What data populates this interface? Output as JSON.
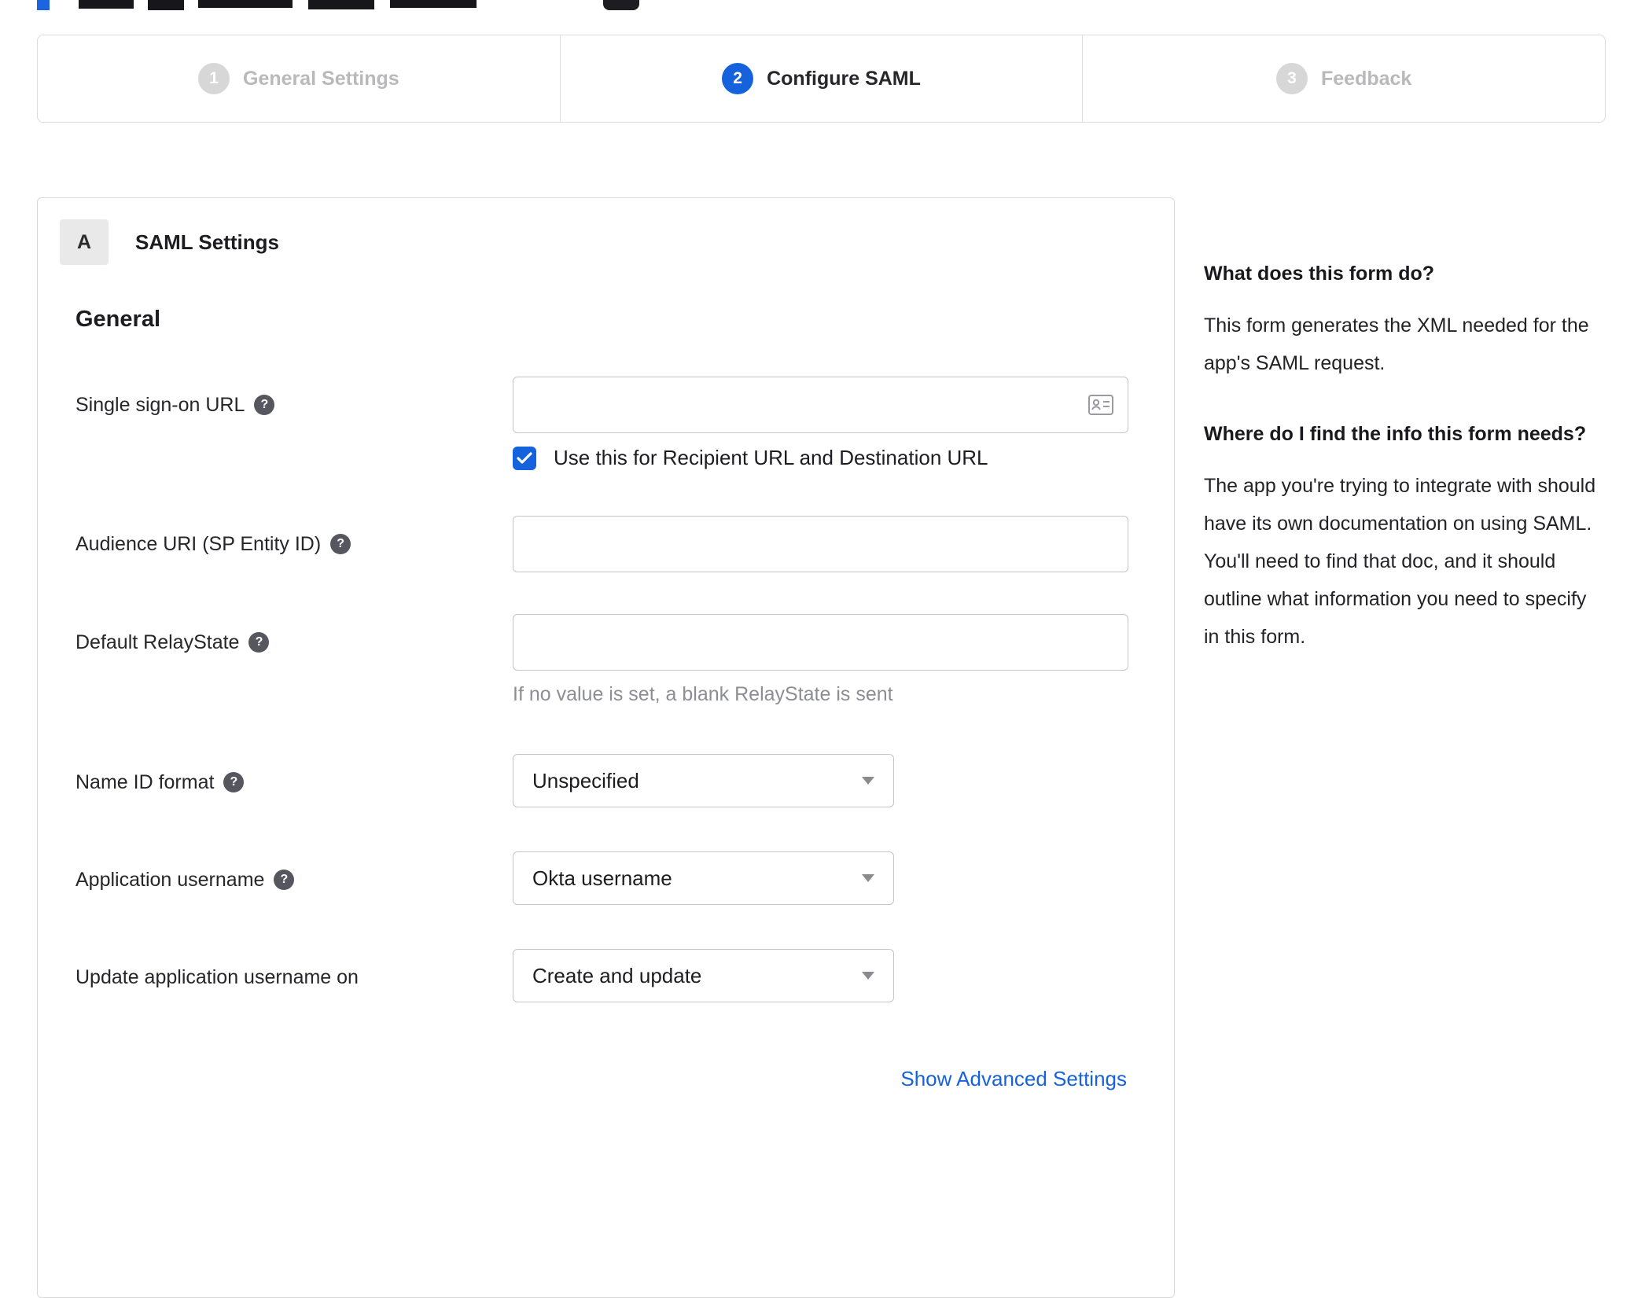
{
  "stepper": {
    "steps": [
      {
        "number": "1",
        "label": "General Settings",
        "state": "inactive"
      },
      {
        "number": "2",
        "label": "Configure SAML",
        "state": "active"
      },
      {
        "number": "3",
        "label": "Feedback",
        "state": "inactive"
      }
    ]
  },
  "panel": {
    "section_badge": "A",
    "section_title": "SAML Settings",
    "group_title": "General",
    "fields": {
      "sso_url": {
        "label": "Single sign-on URL",
        "value": "",
        "checkbox_label": "Use this for Recipient URL and Destination URL",
        "checkbox_checked": true
      },
      "audience_uri": {
        "label": "Audience URI (SP Entity ID)",
        "value": ""
      },
      "relay_state": {
        "label": "Default RelayState",
        "value": "",
        "hint": "If no value is set, a blank RelayState is sent"
      },
      "name_id_format": {
        "label": "Name ID format",
        "value": "Unspecified"
      },
      "app_username": {
        "label": "Application username",
        "value": "Okta username"
      },
      "update_app_username": {
        "label": "Update application username on",
        "value": "Create and update"
      }
    },
    "advanced_link": "Show Advanced Settings"
  },
  "sidebar": {
    "q1": "What does this form do?",
    "a1": "This form generates the XML needed for the app's SAML request.",
    "q2": "Where do I find the info this form needs?",
    "a2": "The app you're trying to integrate with should have its own documentation on using SAML. You'll need to find that doc, and it should outline what information you need to specify in this form."
  },
  "colors": {
    "accent": "#1662dd",
    "inactive_step": "#d7d7d7"
  }
}
